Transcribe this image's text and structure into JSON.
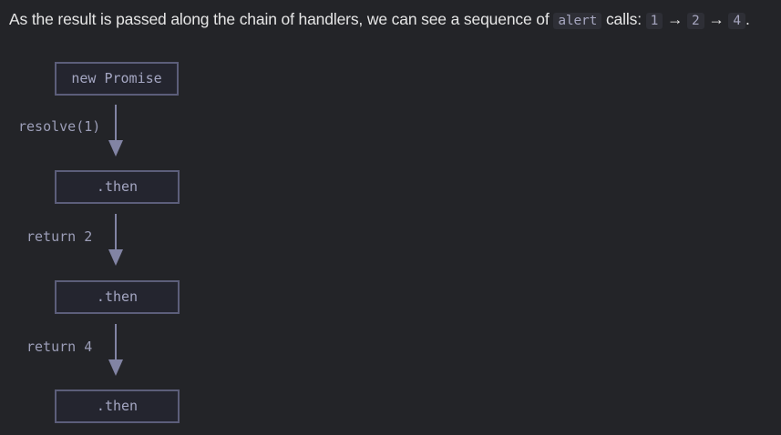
{
  "intro": {
    "text_before": "As the result is passed along the chain of handlers, we can see a sequence of",
    "code_alert": "alert",
    "text_calls": "calls:",
    "seq_1": "1",
    "arrow_1": "→",
    "seq_2": "2",
    "arrow_2": "→",
    "seq_3": "4",
    "end": "."
  },
  "diagram": {
    "nodes": [
      "new Promise",
      ".then",
      ".then",
      ".then"
    ],
    "edge_labels": [
      "resolve(1)",
      "return 2",
      "return 4"
    ],
    "colors": {
      "background": "#232428",
      "box_border": "#5c5e7a",
      "box_text": "#a4a6c2",
      "label_text": "#9c9eb8",
      "arrow": "#8284a4"
    }
  }
}
